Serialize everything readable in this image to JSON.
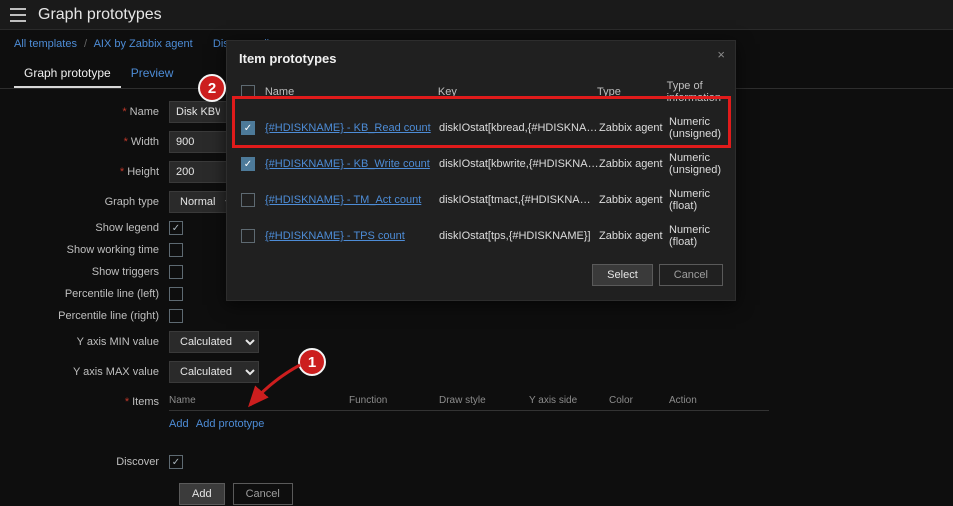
{
  "page": {
    "title": "Graph prototypes"
  },
  "breadcrumbs": {
    "a": "All templates",
    "b": "AIX by Zabbix agent",
    "c": "Discovery lis"
  },
  "tabs": {
    "proto": "Graph prototype",
    "preview": "Preview"
  },
  "form": {
    "name_label": "Name",
    "name_value": "Disk KBWrite/",
    "width_label": "Width",
    "width_value": "900",
    "height_label": "Height",
    "height_value": "200",
    "graph_type_label": "Graph type",
    "graph_type_value": "Normal",
    "show_legend_label": "Show legend",
    "show_working_time_label": "Show working time",
    "show_triggers_label": "Show triggers",
    "percentile_left_label": "Percentile line (left)",
    "percentile_right_label": "Percentile line (right)",
    "yaxis_min_label": "Y axis MIN value",
    "yaxis_min_value": "Calculated",
    "yaxis_max_label": "Y axis MAX value",
    "yaxis_max_value": "Calculated",
    "items_label": "Items",
    "discover_label": "Discover",
    "add_button": "Add",
    "cancel_button": "Cancel"
  },
  "items_table": {
    "headers": {
      "name": "Name",
      "function": "Function",
      "draw_style": "Draw style",
      "yaxis_side": "Y axis side",
      "color": "Color",
      "action": "Action"
    },
    "link_add": "Add",
    "link_add_prototype": "Add prototype"
  },
  "modal": {
    "title": "Item prototypes",
    "headers": {
      "name": "Name",
      "key": "Key",
      "type": "Type",
      "info": "Type of information"
    },
    "rows": [
      {
        "checked": true,
        "name": "{#HDISKNAME} - KB_Read count",
        "key": "diskIOstat[kbread,{#HDISKNAME}]",
        "type": "Zabbix agent",
        "info": "Numeric (unsigned)"
      },
      {
        "checked": true,
        "name": "{#HDISKNAME} - KB_Write count",
        "key": "diskIOstat[kbwrite,{#HDISKNAME}]",
        "type": "Zabbix agent",
        "info": "Numeric (unsigned)"
      },
      {
        "checked": false,
        "name": "{#HDISKNAME} - TM_Act count",
        "key": "diskIOstat[tmact,{#HDISKNAME}]",
        "type": "Zabbix agent",
        "info": "Numeric (float)"
      },
      {
        "checked": false,
        "name": "{#HDISKNAME} - TPS count",
        "key": "diskIOstat[tps,{#HDISKNAME}]",
        "type": "Zabbix agent",
        "info": "Numeric (float)"
      }
    ],
    "select": "Select",
    "cancel": "Cancel"
  },
  "annotations": {
    "marker1": "1",
    "marker2": "2"
  }
}
